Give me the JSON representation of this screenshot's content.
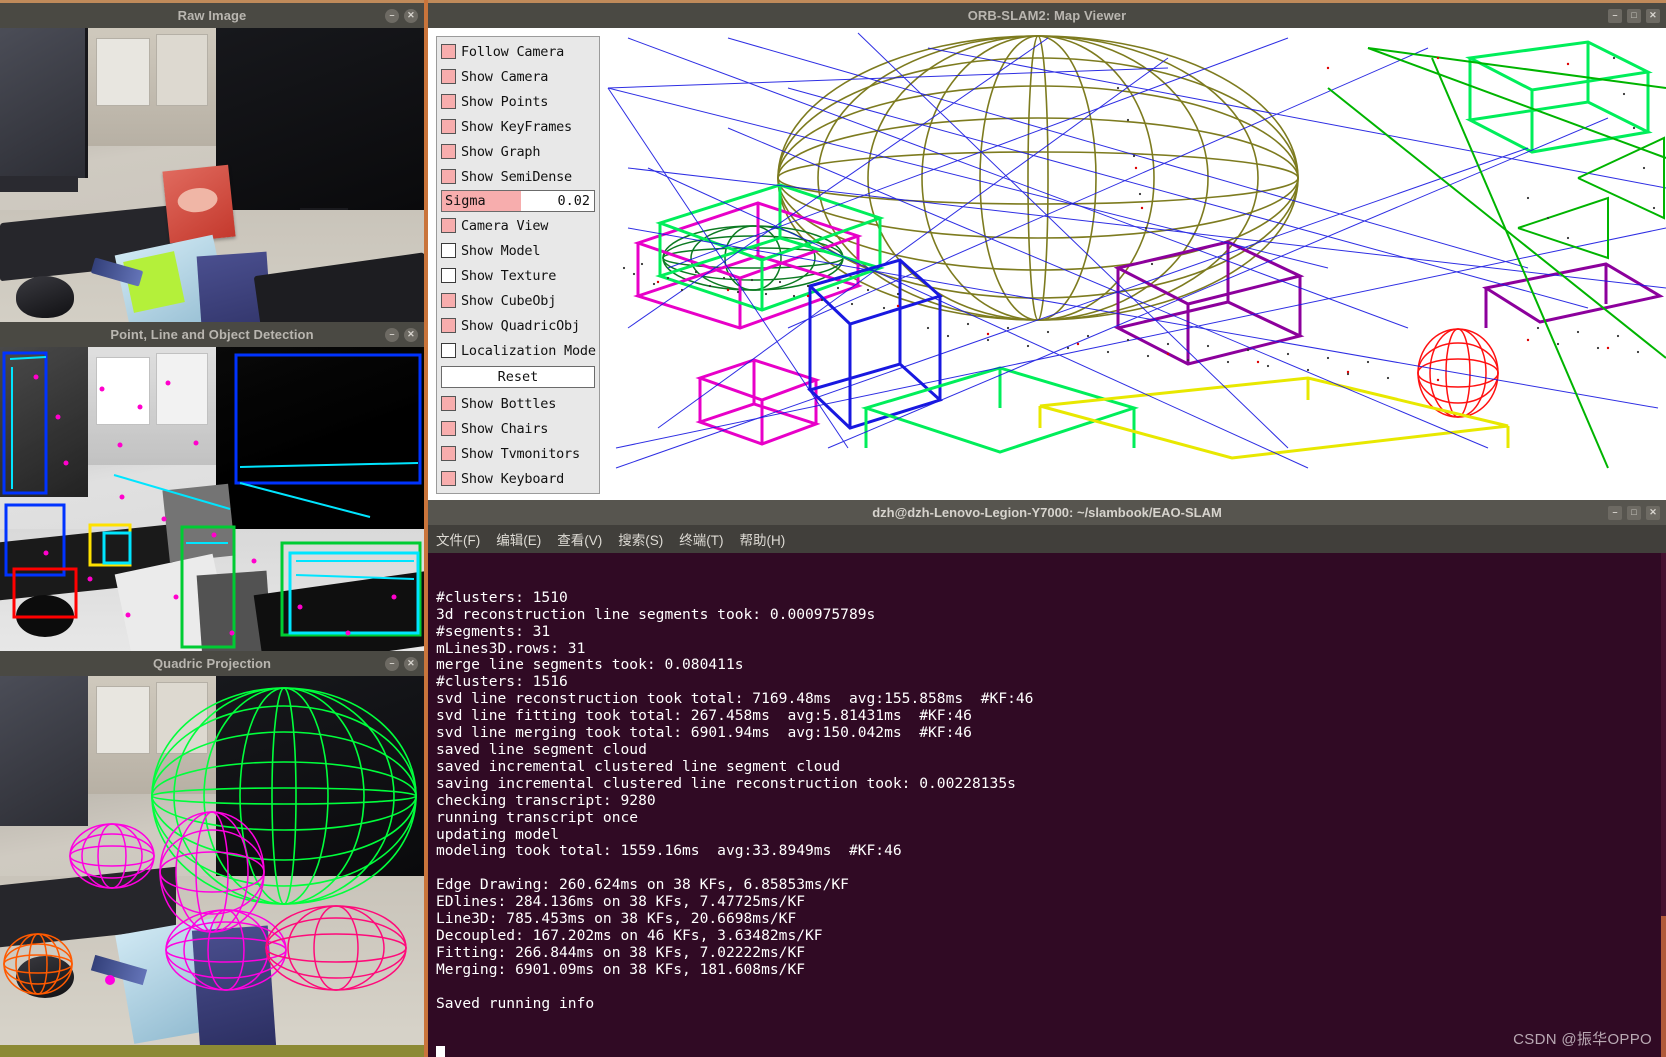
{
  "windows": {
    "raw_image": {
      "title": "Raw Image",
      "buttons": [
        "minimize",
        "close"
      ]
    },
    "detection": {
      "title": "Point, Line and Object Detection",
      "buttons": [
        "minimize",
        "close"
      ]
    },
    "quadric": {
      "title": "Quadric Projection",
      "buttons": [
        "minimize",
        "close"
      ]
    },
    "map_viewer": {
      "title": "ORB-SLAM2: Map Viewer",
      "buttons": [
        "minimize",
        "maximize",
        "close"
      ]
    },
    "terminal": {
      "title": "dzh@dzh-Lenovo-Legion-Y7000: ~/slambook/EAO-SLAM",
      "buttons": [
        "minimize",
        "maximize",
        "close"
      ]
    }
  },
  "panel": {
    "checkboxes": [
      {
        "label": "Follow Camera",
        "checked": true
      },
      {
        "label": "Show Camera",
        "checked": true
      },
      {
        "label": "Show Points",
        "checked": true
      },
      {
        "label": "Show KeyFrames",
        "checked": true
      },
      {
        "label": "Show Graph",
        "checked": true
      },
      {
        "label": "Show SemiDense",
        "checked": true
      }
    ],
    "slider": {
      "name": "Sigma",
      "value": "0.02",
      "fill_percent": 52
    },
    "checkboxes2": [
      {
        "label": "Camera View",
        "checked": true
      },
      {
        "label": "Show Model",
        "checked": false
      },
      {
        "label": "Show Texture",
        "checked": false
      },
      {
        "label": "Show CubeObj",
        "checked": true
      },
      {
        "label": "Show QuadricObj",
        "checked": true
      },
      {
        "label": "Localization Mode",
        "checked": false
      }
    ],
    "reset_label": "Reset",
    "checkboxes3": [
      {
        "label": "Show Bottles",
        "checked": true
      },
      {
        "label": "Show Chairs",
        "checked": true
      },
      {
        "label": "Show Tvmonitors",
        "checked": true
      },
      {
        "label": "Show Keyboard",
        "checked": true
      }
    ],
    "checkbox_color": "#f7adad"
  },
  "terminal": {
    "menu": [
      "文件(F)",
      "编辑(E)",
      "查看(V)",
      "搜索(S)",
      "终端(T)",
      "帮助(H)"
    ],
    "lines": [
      "#clusters: 1510",
      "3d reconstruction line segments took: 0.000975789s",
      "#segments: 31",
      "mLines3D.rows: 31",
      "merge line segments took: 0.080411s",
      "#clusters: 1516",
      "svd line reconstruction took total: 7169.48ms  avg:155.858ms  #KF:46",
      "svd line fitting took total: 267.458ms  avg:5.81431ms  #KF:46",
      "svd line merging took total: 6901.94ms  avg:150.042ms  #KF:46",
      "saved line segment cloud",
      "saved incremental clustered line segment cloud",
      "saving incremental clustered line reconstruction took: 0.00228135s",
      "checking transcript: 9280",
      "running transcript once",
      "updating model",
      "modeling took total: 1559.16ms  avg:33.8949ms  #KF:46",
      "",
      "Edge Drawing: 260.624ms on 38 KFs, 6.85853ms/KF",
      "EDlines: 284.136ms on 38 KFs, 7.47725ms/KF",
      "Line3D: 785.453ms on 38 KFs, 20.6698ms/KF",
      "Decoupled: 167.202ms on 46 KFs, 3.63482ms/KF",
      "Fitting: 266.844ms on 38 KFs, 7.02222ms/KF",
      "Merging: 6901.09ms on 38 KFs, 181.608ms/KF",
      "",
      "Saved running info"
    ],
    "background": "#300a24",
    "foreground": "#ffffff"
  },
  "watermark": "CSDN @振华OPPO",
  "colors": {
    "titlebar": "#4a4943",
    "panel_bg": "#e8e8e8",
    "checkbox_on": "#f7adad",
    "map_bg": "#ffffff",
    "term_bg": "#300a24"
  }
}
